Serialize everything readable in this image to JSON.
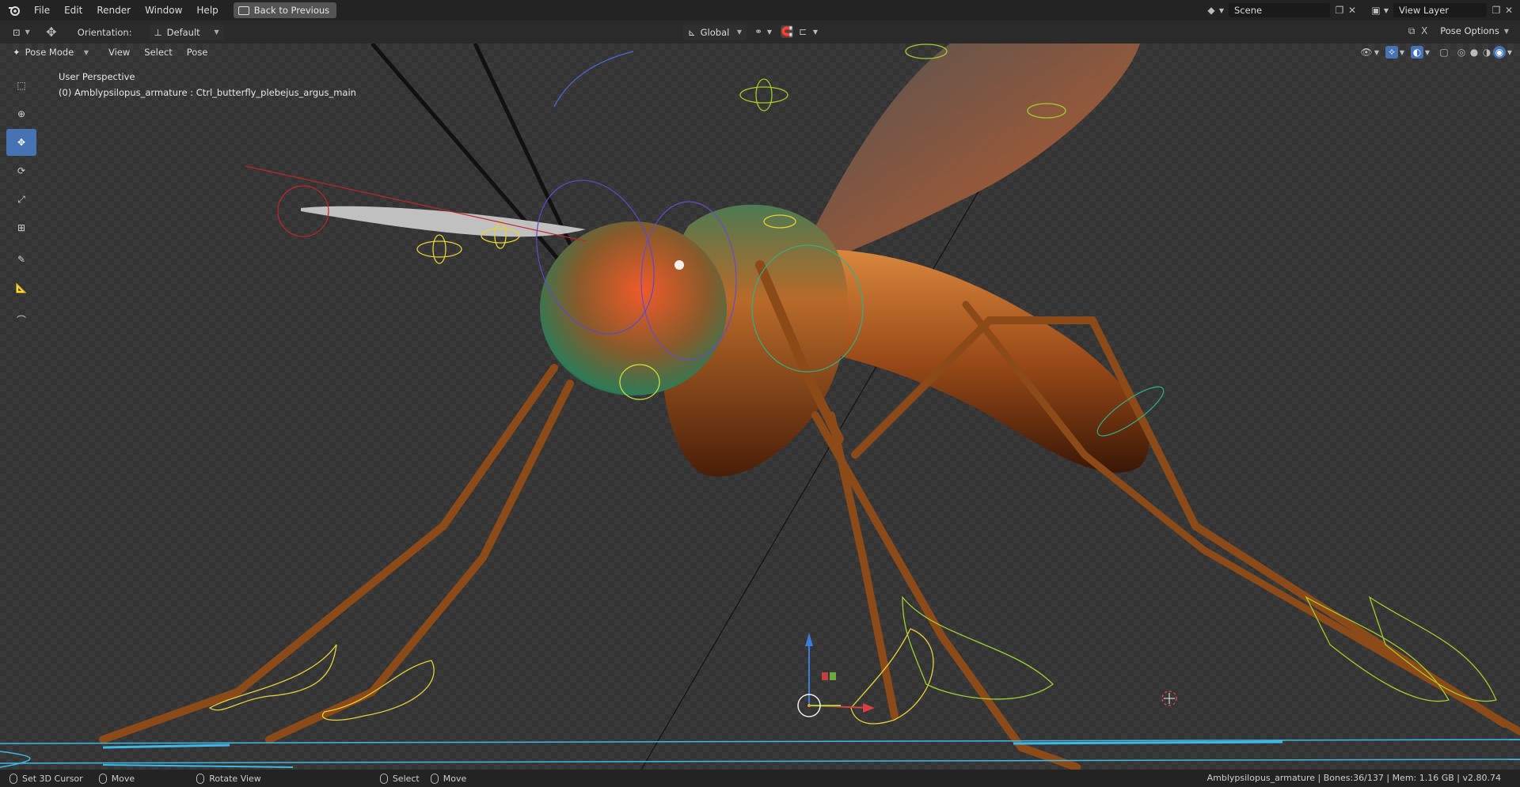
{
  "menu": {
    "items": [
      "File",
      "Edit",
      "Render",
      "Window",
      "Help"
    ],
    "back_button": "Back to Previous"
  },
  "topright": {
    "scene_label": "Scene",
    "viewlayer_label": "View Layer"
  },
  "toolbar": {
    "orientation_label": "Orientation:",
    "orientation_value": "Default",
    "transform_space": "Global",
    "mode": "Pose Mode",
    "menus": [
      "View",
      "Select",
      "Pose"
    ],
    "pose_options": "Pose Options",
    "x_label": "X"
  },
  "viewport": {
    "perspective": "User Perspective",
    "active": "(0) Amblypsilopus_armature : Ctrl_butterfly_plebejus_argus_main"
  },
  "tools": [
    "select-box-icon",
    "cursor-icon",
    "move-icon",
    "rotate-icon",
    "scale-icon",
    "transform-icon",
    "annotate-icon",
    "measure-icon",
    "bone-icon"
  ],
  "status": {
    "items": [
      "Set 3D Cursor",
      "Move",
      "Rotate View",
      "Select",
      "Move"
    ],
    "info": "Amblypsilopus_armature | Bones:36/137  | Mem: 1.16 GB | v2.80.74"
  },
  "colors": {
    "accent": "#4772b3",
    "insect_body": "#a8541f",
    "wire_yellow": "#e8d23a",
    "wire_cyan": "#3fb8e6"
  }
}
